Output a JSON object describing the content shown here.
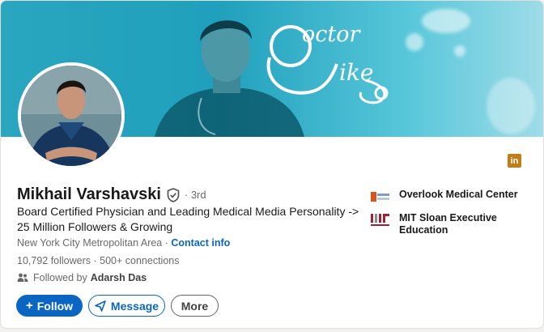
{
  "banner": {
    "logo_word_1": "octor",
    "logo_word_2": "ike",
    "accent": "#1fa0bc"
  },
  "profile": {
    "name": "Mikhail Varshavski",
    "verified_icon": "shield-check-icon",
    "degree": "· 3rd",
    "headline": "Board Certified Physician and Leading Medical Media Personality -> 25 Million Followers & Growing",
    "location": "New York City Metropolitan Area",
    "location_sep": " · ",
    "contact_info": "Contact info",
    "followers": "10,792 followers",
    "connections_sep": " · ",
    "connections": "500+ connections",
    "followed_by_prefix": "Followed by",
    "followed_by_name": "Adarsh Das"
  },
  "actions": {
    "follow_label": "Follow",
    "message_label": "Message",
    "more_label": "More"
  },
  "orgs": [
    {
      "name": "Overlook Medical Center",
      "logo": "overlook-logo"
    },
    {
      "name": "MIT Sloan Executive Education",
      "logo": "mit-logo"
    }
  ],
  "colors": {
    "brand_blue": "#0a66c2",
    "linkedin_badge": "#c37d16"
  },
  "linkedin_badge": "in"
}
